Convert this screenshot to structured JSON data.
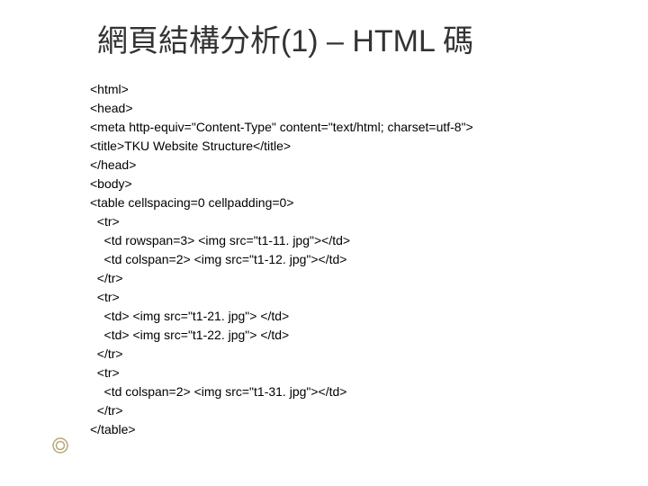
{
  "title": "網頁結構分析(1) – HTML 碼",
  "code": {
    "l1": "<html>",
    "l2": "<head>",
    "l3": "<meta http-equiv=\"Content-Type\" content=\"text/html; charset=utf-8\">",
    "l4": "<title>TKU Website Structure</title>",
    "l5": "</head>",
    "l6": "<body>",
    "l7": "<table cellspacing=0 cellpadding=0>",
    "l8": "  <tr>",
    "l9": "    <td rowspan=3> <img src=\"t1-11. jpg\"></td>",
    "l10": "    <td colspan=2> <img src=\"t1-12. jpg\"></td>",
    "l11": "  </tr>",
    "l12": "  <tr>",
    "l13": "    <td> <img src=\"t1-21. jpg\"> </td>",
    "l14": "    <td> <img src=\"t1-22. jpg\"> </td>",
    "l15": "  </tr>",
    "l16": "  <tr>",
    "l17": "    <td colspan=2> <img src=\"t1-31. jpg\"></td>",
    "l18": "  </tr>",
    "l19": "</table>"
  }
}
